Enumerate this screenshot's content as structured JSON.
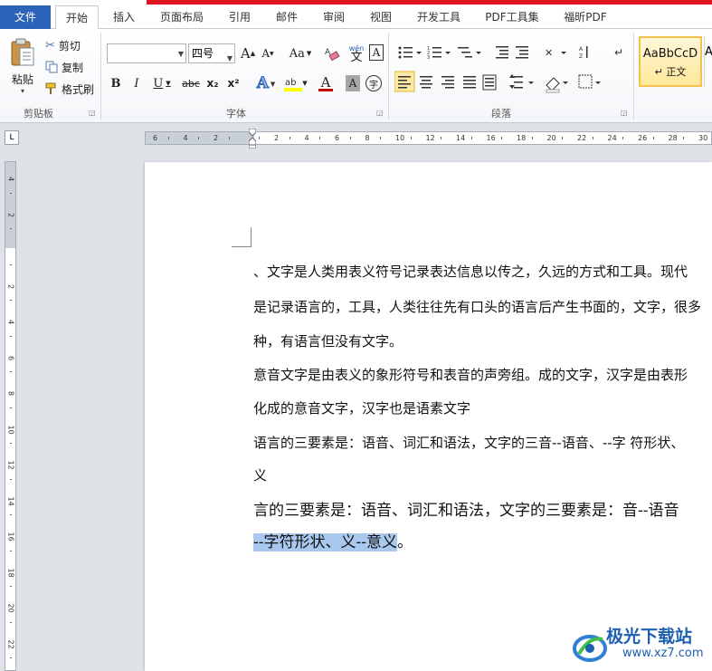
{
  "tabs": [
    {
      "label": "文件"
    },
    {
      "label": "开始"
    },
    {
      "label": "插入"
    },
    {
      "label": "页面布局"
    },
    {
      "label": "引用"
    },
    {
      "label": "邮件"
    },
    {
      "label": "审阅"
    },
    {
      "label": "视图"
    },
    {
      "label": "开发工具"
    },
    {
      "label": "PDF工具集"
    },
    {
      "label": "福昕PDF"
    }
  ],
  "clipboard": {
    "paste_label": "粘贴",
    "cut_label": "剪切",
    "copy_label": "复制",
    "format_painter_label": "格式刷",
    "group_label": "剪贴板"
  },
  "font": {
    "font_name_value": "",
    "font_size_value": "四号",
    "group_label": "字体",
    "bold": "B",
    "italic": "I",
    "underline": "U",
    "strike": "abc",
    "subscript": "x₂",
    "superscript": "x²",
    "grow": "A",
    "shrink": "A",
    "case": "Aa",
    "phonetic": "wén",
    "phonetic_sub": "文",
    "border_char": "A",
    "font_color": "A",
    "char_shade": "A",
    "enclose": "字",
    "text_effect": "A"
  },
  "paragraph": {
    "group_label": "段落"
  },
  "styles": {
    "sample": "AaBbCcD",
    "normal_label": "↵ 正文",
    "next_sample": "A"
  },
  "ruler": {
    "h_ticks": [
      "6",
      "4",
      "2",
      "",
      "2",
      "4",
      "6",
      "8",
      "10",
      "12",
      "14",
      "16",
      "18",
      "20",
      "22",
      "24",
      "26",
      "28",
      "30"
    ],
    "v_ticks": [
      "4",
      "2",
      "",
      "2",
      "4",
      "6",
      "8",
      "10",
      "12",
      "14",
      "16",
      "18",
      "20",
      "22"
    ]
  },
  "document": {
    "lines": [
      "、文字是人类用表义符号记录表达信息以传之，久远的方式和工具。现代",
      "是记录语言的，工具，人类往往先有口头的语言后产生书面的，文字，很多",
      "种，有语言但没有文字。",
      "意音文字是由表义的象形符号和表音的声旁组。成的文字，汉字是由表形",
      "化成的意音文字，汉字也是语素文字",
      "语言的三要素是：语音、词汇和语法，文字的三音--语音、--字  符形状、",
      "义",
      "言的三要素是：语音、词汇和语法，文字的三要素是：音--语音",
      "--字符形状、义--意义",
      "。"
    ]
  },
  "watermark": {
    "title": "极光下载站",
    "url": "www.xz7.com"
  },
  "colors": {
    "file_tab": "#2b63b8",
    "highlight": "#a8c8ee",
    "top_strip": "#e0141e",
    "style_border": "#f2c14e"
  }
}
